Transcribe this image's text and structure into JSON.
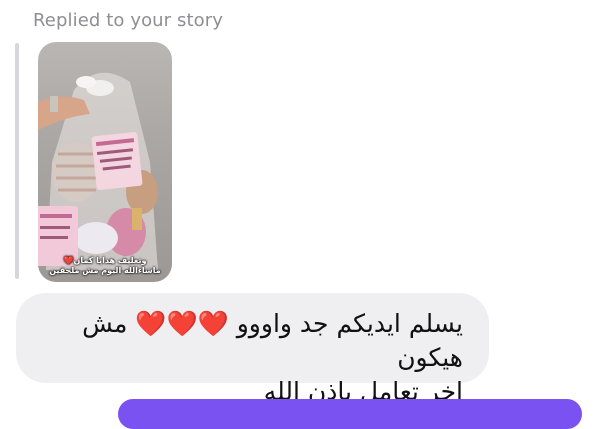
{
  "reply": {
    "header": "Replied to your story"
  },
  "story": {
    "caption_line1": "وتغليف هدايا كمان",
    "caption_heart": "❤️",
    "caption_line2": "ماشاءالله اليوم مش ملحقين"
  },
  "message": {
    "line1_start": "يسلم ايديكم جد واووو",
    "hearts": "❤️❤️❤️",
    "line1_end": "مش هيكون",
    "line2": "اخر تعامل بإذن الله"
  },
  "colors": {
    "accent": "#7a52f2",
    "bubble": "#efeff2",
    "meta_text": "#8e8e93"
  }
}
